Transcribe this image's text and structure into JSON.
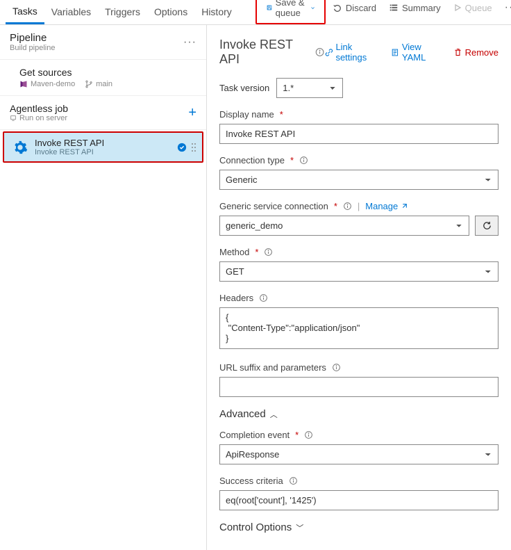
{
  "tabs": {
    "tasks": "Tasks",
    "variables": "Variables",
    "triggers": "Triggers",
    "options": "Options",
    "history": "History"
  },
  "toolbar": {
    "save": "Save & queue",
    "discard": "Discard",
    "summary": "Summary",
    "queue": "Queue"
  },
  "sidebar": {
    "pipeline": {
      "title": "Pipeline",
      "sub": "Build pipeline"
    },
    "getSources": {
      "title": "Get sources",
      "repo": "Maven-demo",
      "branch": "main"
    },
    "job": {
      "title": "Agentless job",
      "sub": "Run on server"
    },
    "task": {
      "name": "Invoke REST API",
      "type": "Invoke REST API"
    }
  },
  "panel": {
    "title": "Invoke REST API",
    "actions": {
      "link": "Link settings",
      "yaml": "View YAML",
      "remove": "Remove"
    },
    "taskVersion": {
      "label": "Task version",
      "value": "1.*"
    },
    "displayName": {
      "label": "Display name",
      "value": "Invoke REST API"
    },
    "connType": {
      "label": "Connection type",
      "value": "Generic"
    },
    "serviceConn": {
      "label": "Generic service connection",
      "manage": "Manage",
      "value": "generic_demo"
    },
    "method": {
      "label": "Method",
      "value": "GET"
    },
    "headers": {
      "label": "Headers",
      "value": "{\n \"Content-Type\":\"application/json\"\n}"
    },
    "urlSuffix": {
      "label": "URL suffix and parameters",
      "value": ""
    },
    "advanced": "Advanced",
    "completion": {
      "label": "Completion event",
      "value": "ApiResponse"
    },
    "criteria": {
      "label": "Success criteria",
      "value": "eq(root['count'], '1425')"
    },
    "controlOptions": "Control Options"
  }
}
